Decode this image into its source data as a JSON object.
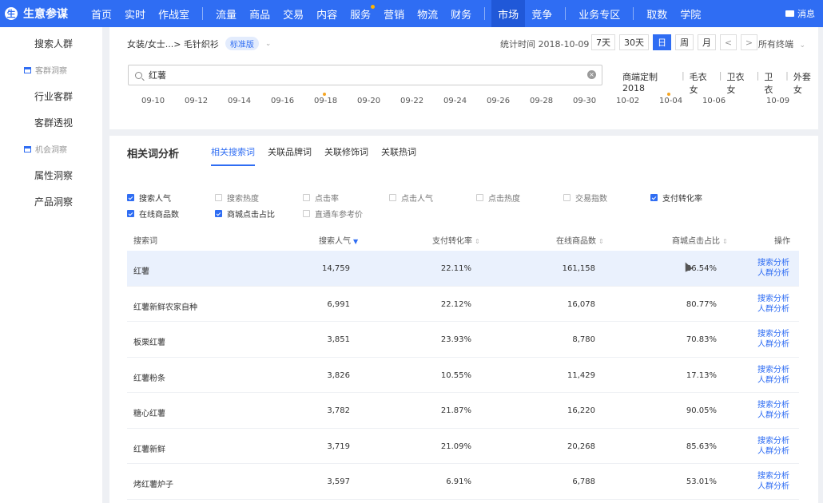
{
  "brand": {
    "logo": "生",
    "name": "生意参谋"
  },
  "topnav": {
    "items": [
      "首页",
      "实时",
      "作战室",
      "流量",
      "商品",
      "交易",
      "内容",
      "服务",
      "营销",
      "物流",
      "财务",
      "市场",
      "竞争",
      "业务专区",
      "取数",
      "学院"
    ],
    "message": "消息"
  },
  "sidebar": {
    "items": [
      "搜索人群",
      "客群洞察",
      "行业客群",
      "客群透视",
      "机会洞察",
      "属性洞察",
      "产品洞察"
    ]
  },
  "filter": {
    "breadcrumb": "女装/女士...> 毛针织衫",
    "edition_badge": "标准版",
    "stat_time": "统计时间 2018-10-09",
    "periods": [
      "7天",
      "30天",
      "日",
      "周",
      "月"
    ],
    "prev": "<",
    "next": ">",
    "terminal": "所有终端",
    "search_value": "红薯",
    "quick_terms": [
      "商端定制2018",
      "毛衣女",
      "卫衣女",
      "卫衣",
      "外套女"
    ],
    "axis_dates": [
      "09-10",
      "09-12",
      "09-14",
      "09-16",
      "09-18",
      "09-20",
      "09-22",
      "09-24",
      "09-26",
      "09-28",
      "09-30",
      "10-02",
      "10-04",
      "10-06",
      "10-09"
    ]
  },
  "analysis": {
    "title": "相关词分析",
    "tabs": [
      "相关搜索词",
      "关联品牌词",
      "关联修饰词",
      "关联热词"
    ],
    "metrics": [
      {
        "label": "搜索人气",
        "checked": true
      },
      {
        "label": "搜索热度",
        "checked": false
      },
      {
        "label": "点击率",
        "checked": false
      },
      {
        "label": "点击人气",
        "checked": false
      },
      {
        "label": "点击热度",
        "checked": false
      },
      {
        "label": "交易指数",
        "checked": false
      },
      {
        "label": "支付转化率",
        "checked": true
      },
      {
        "label": "在线商品数",
        "checked": true
      },
      {
        "label": "商城点击占比",
        "checked": true
      },
      {
        "label": "直通车参考价",
        "checked": false
      }
    ],
    "columns": [
      "搜索词",
      "搜索人气",
      "支付转化率",
      "在线商品数",
      "商城点击占比",
      "操作"
    ],
    "rows": [
      {
        "keyword": "红薯",
        "popularity": "14,759",
        "conversion": "22.11%",
        "products": "161,158",
        "mall_ratio": "86.54%"
      },
      {
        "keyword": "红薯新鲜农家自种",
        "popularity": "6,991",
        "conversion": "22.12%",
        "products": "16,078",
        "mall_ratio": "80.77%"
      },
      {
        "keyword": "板栗红薯",
        "popularity": "3,851",
        "conversion": "23.93%",
        "products": "8,780",
        "mall_ratio": "70.83%"
      },
      {
        "keyword": "红薯粉条",
        "popularity": "3,826",
        "conversion": "10.55%",
        "products": "11,429",
        "mall_ratio": "17.13%"
      },
      {
        "keyword": "糖心红薯",
        "popularity": "3,782",
        "conversion": "21.87%",
        "products": "16,220",
        "mall_ratio": "90.05%"
      },
      {
        "keyword": "红薯新鲜",
        "popularity": "3,719",
        "conversion": "21.09%",
        "products": "20,268",
        "mall_ratio": "85.63%"
      },
      {
        "keyword": "烤红薯炉子",
        "popularity": "3,597",
        "conversion": "6.91%",
        "products": "6,788",
        "mall_ratio": "53.01%"
      }
    ],
    "op_search": "搜索分析",
    "op_crowd": "人群分析"
  },
  "colors": {
    "primary": "#2f6df3",
    "highlight_row": "#eaf1fd",
    "marker": "#f5a623"
  }
}
